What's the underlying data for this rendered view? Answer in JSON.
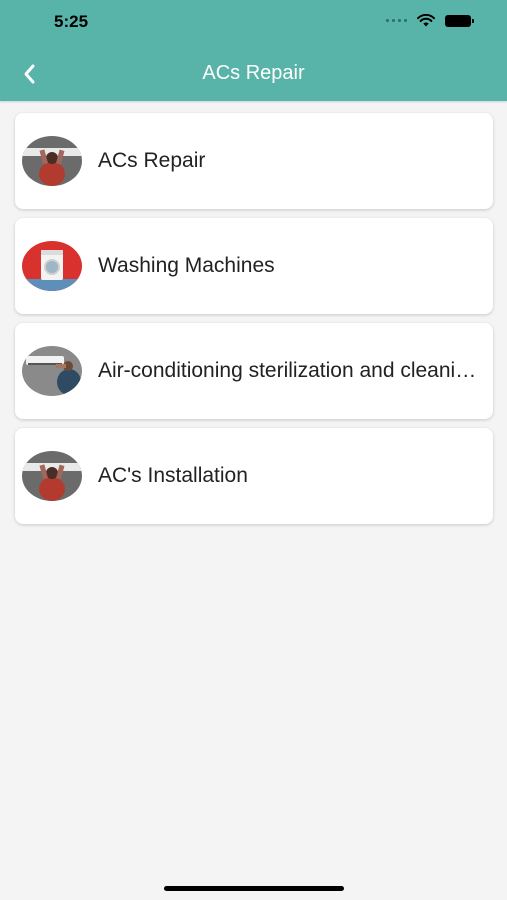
{
  "status_bar": {
    "time": "5:25"
  },
  "header": {
    "title": "ACs Repair"
  },
  "services": [
    {
      "label": "ACs Repair",
      "icon": "ac-repair-thumbnail"
    },
    {
      "label": "Washing Machines",
      "icon": "washing-machine-thumbnail"
    },
    {
      "label": "Air-conditioning sterilization and cleaning",
      "icon": "ac-sterilization-thumbnail"
    },
    {
      "label": "AC's Installation",
      "icon": "ac-installation-thumbnail"
    }
  ],
  "colors": {
    "accent": "#58b4a9",
    "background": "#f4f4f4",
    "card": "#ffffff"
  }
}
